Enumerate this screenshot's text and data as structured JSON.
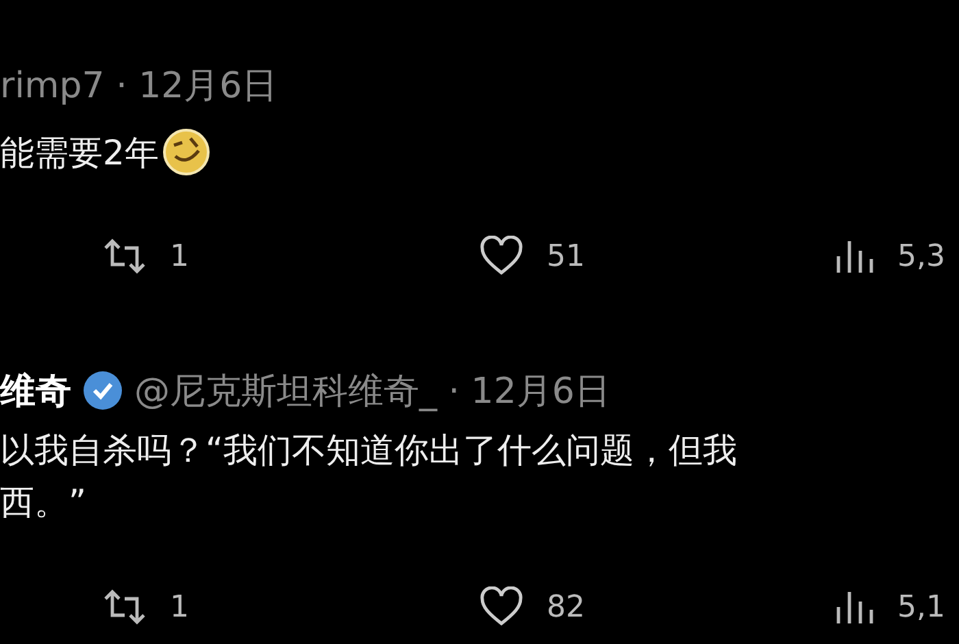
{
  "replies": [
    {
      "handle": "rimp7",
      "verified": false,
      "separator": "·",
      "date": "12月6日",
      "lines": [
        "能需要2年"
      ],
      "emoji": true,
      "stats": {
        "reposts": "1",
        "likes": "51",
        "views": "5,3"
      }
    },
    {
      "author_name": "维奇",
      "handle": "@尼克斯坦科维奇_",
      "verified": true,
      "separator": "·",
      "date": "12月6日",
      "lines": [
        "以我自杀吗？“我们不知道你出了什么问题，但我",
        "西。”"
      ],
      "emoji": false,
      "stats": {
        "reposts": "1",
        "likes": "82",
        "views": "5,1"
      }
    }
  ]
}
